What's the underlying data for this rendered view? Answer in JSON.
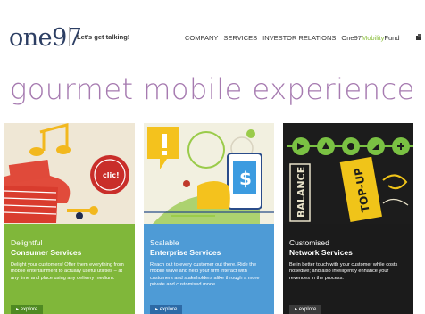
{
  "header": {
    "logo": "one97",
    "tagline": "Let's get talking!",
    "nav": {
      "company": "COMPANY",
      "services": "SERVICES",
      "investor_relations": "INVESTOR RELATIONS",
      "fund_prefix": "One97",
      "fund_accent": "Mobility",
      "fund_suffix": "Fund"
    },
    "nav_icon": "graphic-icon"
  },
  "hero": {
    "title": "gourmet mobile experience"
  },
  "cards": [
    {
      "line1": "Delightful",
      "line2": "Consumer Services",
      "desc": "Delight your customers! Offer them everything from mobile entertainment to actually useful utilities – at any time and place using any delivery medium.",
      "button": "explore",
      "art_icon": "mobile-entertainment-illustration",
      "art_text": "clic!"
    },
    {
      "line1": "Scalable",
      "line2": "Enterprise Services",
      "desc": "Reach out to every customer out there. Ride the mobile wave and help your firm interact with customers and stakeholders alike through a more private and customised mode.",
      "button": "explore",
      "art_icon": "mobile-payment-illustration",
      "art_text": "$"
    },
    {
      "line1": "Customised",
      "line2": "Network Services",
      "desc": "Be in better touch with your customer while costs nosedive; and also intelligently enhance your revenues in the process.",
      "button": "explore",
      "art_icon": "balance-topup-illustration",
      "art_text_1": "BALANCE",
      "art_text_2": "TOP-UP"
    }
  ],
  "colors": {
    "logo": "#2c3e63",
    "hero": "#a67ab0",
    "consumer": "#80b73a",
    "enterprise": "#4e9bd6",
    "network": "#1b1b1b",
    "fund_accent": "#8cbf3f"
  }
}
